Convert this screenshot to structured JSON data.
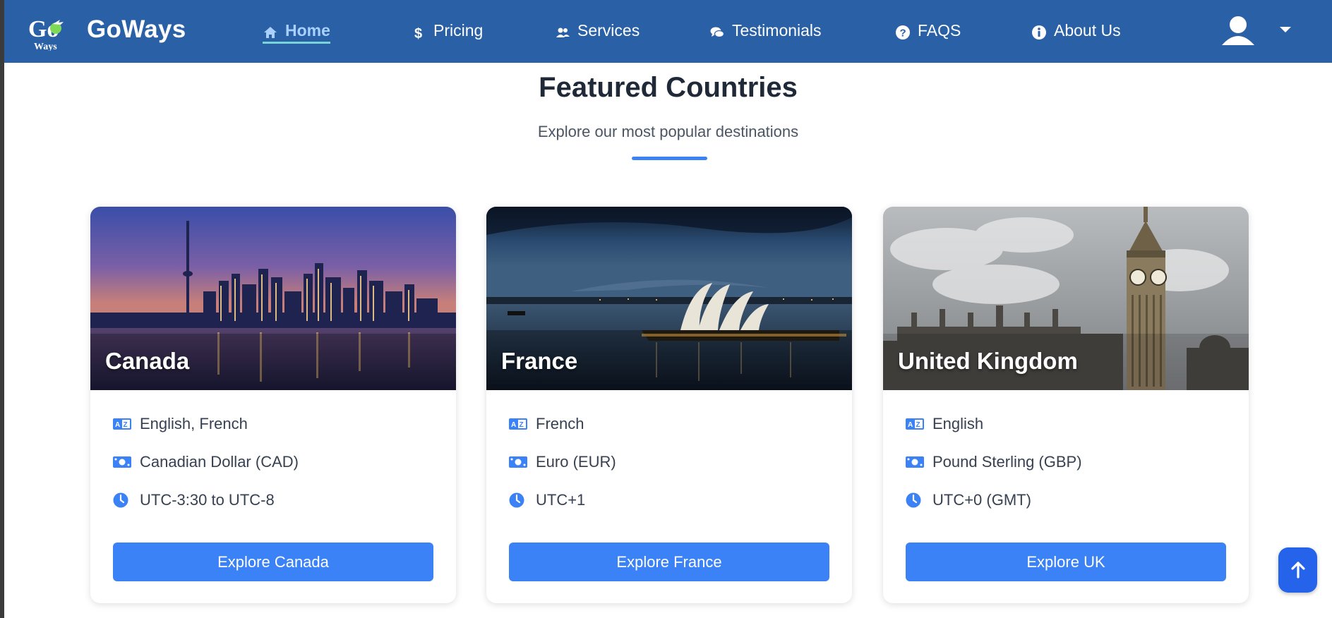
{
  "app": {
    "brand": "GoWays",
    "logo_text_top": "Go",
    "logo_text_bottom": "Ways"
  },
  "nav": {
    "items": [
      {
        "label": "Home",
        "icon": "home-icon",
        "active": true
      },
      {
        "label": "Pricing",
        "icon": "dollar-icon",
        "active": false
      },
      {
        "label": "Services",
        "icon": "users-icon",
        "active": false
      },
      {
        "label": "Testimonials",
        "icon": "comments-icon",
        "active": false
      },
      {
        "label": "FAQS",
        "icon": "question-circle-icon",
        "active": false
      },
      {
        "label": "About Us",
        "icon": "info-circle-icon",
        "active": false
      }
    ],
    "user_menu": {
      "icon": "user-icon",
      "caret": "chevron-down-icon"
    }
  },
  "section": {
    "title": "Featured Countries",
    "subtitle": "Explore our most popular destinations"
  },
  "cards": [
    {
      "name": "Canada",
      "language": "English, French",
      "currency": "Canadian Dollar (CAD)",
      "timezone": "UTC-3:30 to UTC-8",
      "button": "Explore Canada",
      "image": "toronto-skyline-night"
    },
    {
      "name": "France",
      "language": "French",
      "currency": "Euro (EUR)",
      "timezone": "UTC+1",
      "button": "Explore France",
      "image": "sydney-opera-house-dusk"
    },
    {
      "name": "United Kingdom",
      "language": "English",
      "currency": "Pound Sterling (GBP)",
      "timezone": "UTC+0 (GMT)",
      "button": "Explore UK",
      "image": "big-ben-cloudy"
    }
  ],
  "colors": {
    "navbar": "#2a60a6",
    "accent": "#3b82f6",
    "active_nav": "#a9d0ff"
  }
}
